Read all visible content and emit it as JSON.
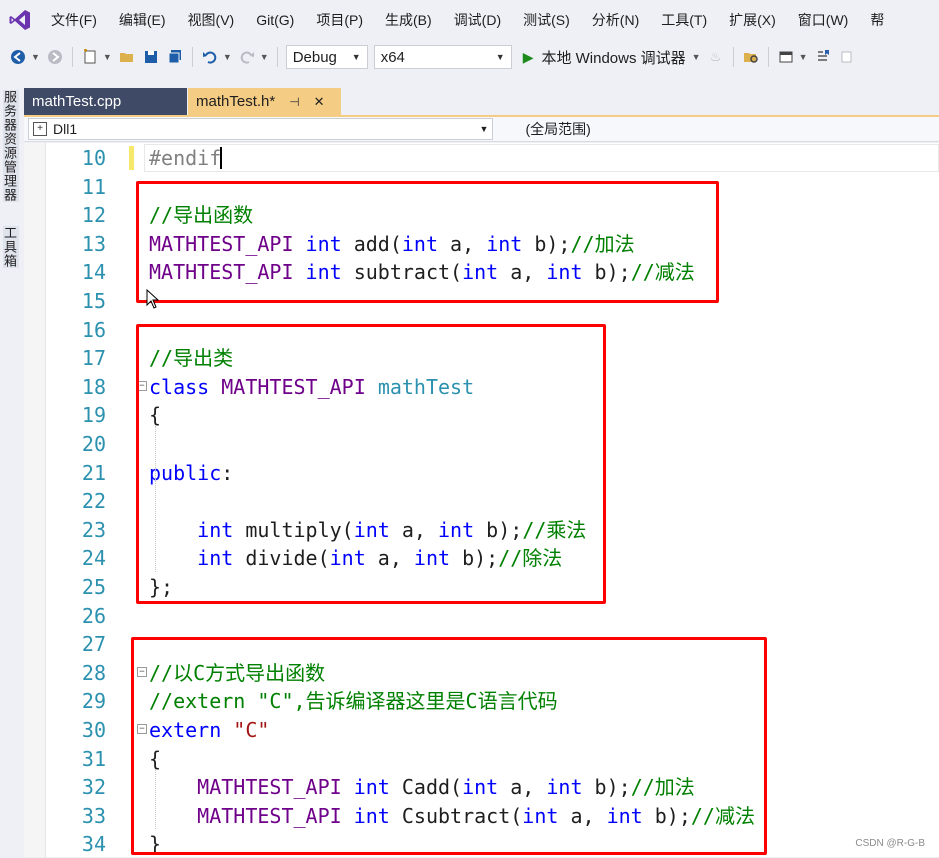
{
  "menu": {
    "items": [
      "文件(F)",
      "编辑(E)",
      "视图(V)",
      "Git(G)",
      "项目(P)",
      "生成(B)",
      "调试(D)",
      "测试(S)",
      "分析(N)",
      "工具(T)",
      "扩展(X)",
      "窗口(W)",
      "帮"
    ]
  },
  "toolbar": {
    "config": "Debug",
    "platform": "x64",
    "run_label": "本地 Windows 调试器"
  },
  "side_panels": [
    "服务器资源管理器",
    "工具箱"
  ],
  "tabs": [
    {
      "label": "mathTest.cpp",
      "active": false
    },
    {
      "label": "mathTest.h*",
      "active": true,
      "pin": "⊣",
      "close": "✕"
    }
  ],
  "nav": {
    "project": "Dll1",
    "scope": "(全局范围)"
  },
  "code_lines": [
    {
      "no": "10",
      "tokens": [
        {
          "c": "pre",
          "t": "#endif"
        }
      ]
    },
    {
      "no": "11",
      "tokens": []
    },
    {
      "no": "12",
      "tokens": [
        {
          "c": "cmt",
          "t": "//导出函数"
        }
      ]
    },
    {
      "no": "13",
      "tokens": [
        {
          "c": "mac",
          "t": "MATHTEST_API"
        },
        {
          "c": "plain",
          "t": " "
        },
        {
          "c": "kw",
          "t": "int"
        },
        {
          "c": "plain",
          "t": " add("
        },
        {
          "c": "kw",
          "t": "int"
        },
        {
          "c": "plain",
          "t": " a, "
        },
        {
          "c": "kw",
          "t": "int"
        },
        {
          "c": "plain",
          "t": " b);"
        },
        {
          "c": "cmt",
          "t": "//加法"
        }
      ]
    },
    {
      "no": "14",
      "tokens": [
        {
          "c": "mac",
          "t": "MATHTEST_API"
        },
        {
          "c": "plain",
          "t": " "
        },
        {
          "c": "kw",
          "t": "int"
        },
        {
          "c": "plain",
          "t": " subtract("
        },
        {
          "c": "kw",
          "t": "int"
        },
        {
          "c": "plain",
          "t": " a, "
        },
        {
          "c": "kw",
          "t": "int"
        },
        {
          "c": "plain",
          "t": " b);"
        },
        {
          "c": "cmt",
          "t": "//减法"
        }
      ]
    },
    {
      "no": "15",
      "tokens": []
    },
    {
      "no": "16",
      "tokens": []
    },
    {
      "no": "17",
      "tokens": [
        {
          "c": "cmt",
          "t": "//导出类"
        }
      ]
    },
    {
      "no": "18",
      "fold": "⊟",
      "tokens": [
        {
          "c": "kw",
          "t": "class"
        },
        {
          "c": "plain",
          "t": " "
        },
        {
          "c": "mac",
          "t": "MATHTEST_API"
        },
        {
          "c": "plain",
          "t": " "
        },
        {
          "c": "typ",
          "t": "mathTest"
        }
      ]
    },
    {
      "no": "19",
      "tokens": [
        {
          "c": "plain",
          "t": "{"
        }
      ]
    },
    {
      "no": "20",
      "tokens": []
    },
    {
      "no": "21",
      "tokens": [
        {
          "c": "kw",
          "t": "public"
        },
        {
          "c": "plain",
          "t": ":"
        }
      ]
    },
    {
      "no": "22",
      "tokens": []
    },
    {
      "no": "23",
      "tokens": [
        {
          "c": "plain",
          "t": "    "
        },
        {
          "c": "kw",
          "t": "int"
        },
        {
          "c": "plain",
          "t": " multiply("
        },
        {
          "c": "kw",
          "t": "int"
        },
        {
          "c": "plain",
          "t": " a, "
        },
        {
          "c": "kw",
          "t": "int"
        },
        {
          "c": "plain",
          "t": " b);"
        },
        {
          "c": "cmt",
          "t": "//乘法"
        }
      ]
    },
    {
      "no": "24",
      "tokens": [
        {
          "c": "plain",
          "t": "    "
        },
        {
          "c": "kw",
          "t": "int"
        },
        {
          "c": "plain",
          "t": " divide("
        },
        {
          "c": "kw",
          "t": "int"
        },
        {
          "c": "plain",
          "t": " a, "
        },
        {
          "c": "kw",
          "t": "int"
        },
        {
          "c": "plain",
          "t": " b);"
        },
        {
          "c": "cmt",
          "t": "//除法"
        }
      ]
    },
    {
      "no": "25",
      "tokens": [
        {
          "c": "plain",
          "t": "};"
        }
      ]
    },
    {
      "no": "26",
      "tokens": []
    },
    {
      "no": "27",
      "tokens": []
    },
    {
      "no": "28",
      "fold": "⊟",
      "tokens": [
        {
          "c": "cmt",
          "t": "//以C方式导出函数"
        }
      ]
    },
    {
      "no": "29",
      "tokens": [
        {
          "c": "cmt",
          "t": "//extern \"C\",告诉编译器这里是C语言代码"
        }
      ]
    },
    {
      "no": "30",
      "fold": "⊟",
      "tokens": [
        {
          "c": "kw",
          "t": "extern"
        },
        {
          "c": "plain",
          "t": " "
        },
        {
          "c": "str",
          "t": "\"C\""
        }
      ]
    },
    {
      "no": "31",
      "tokens": [
        {
          "c": "plain",
          "t": "{"
        }
      ]
    },
    {
      "no": "32",
      "tokens": [
        {
          "c": "plain",
          "t": "    "
        },
        {
          "c": "mac",
          "t": "MATHTEST_API"
        },
        {
          "c": "plain",
          "t": " "
        },
        {
          "c": "kw",
          "t": "int"
        },
        {
          "c": "plain",
          "t": " Cadd("
        },
        {
          "c": "kw",
          "t": "int"
        },
        {
          "c": "plain",
          "t": " a, "
        },
        {
          "c": "kw",
          "t": "int"
        },
        {
          "c": "plain",
          "t": " b);"
        },
        {
          "c": "cmt",
          "t": "//加法"
        }
      ]
    },
    {
      "no": "33",
      "tokens": [
        {
          "c": "plain",
          "t": "    "
        },
        {
          "c": "mac",
          "t": "MATHTEST_API"
        },
        {
          "c": "plain",
          "t": " "
        },
        {
          "c": "kw",
          "t": "int"
        },
        {
          "c": "plain",
          "t": " Csubtract("
        },
        {
          "c": "kw",
          "t": "int"
        },
        {
          "c": "plain",
          "t": " a, "
        },
        {
          "c": "kw",
          "t": "int"
        },
        {
          "c": "plain",
          "t": " b);"
        },
        {
          "c": "cmt",
          "t": "//减法"
        }
      ]
    },
    {
      "no": "34",
      "tokens": [
        {
          "c": "plain",
          "t": "}"
        }
      ]
    }
  ],
  "colors": {
    "keyword": "#0000ff",
    "macro": "#6f008a",
    "type": "#2b91af",
    "comment": "#008000",
    "string": "#a31515",
    "preprocessor": "#808080",
    "annotation_red": "#ff0000",
    "active_tab": "#f5cc84",
    "inactive_tab": "#3f4a66"
  },
  "watermark": "CSDN @R-G-B"
}
